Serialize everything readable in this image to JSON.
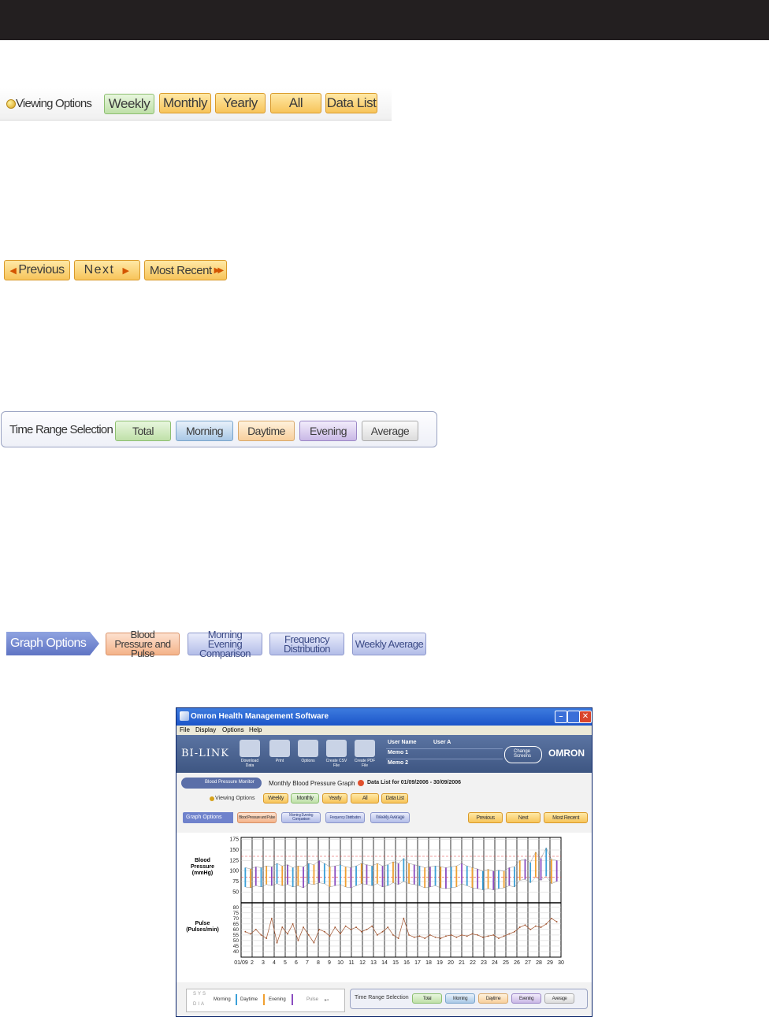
{
  "viewing_options": {
    "label": "Viewing Options",
    "buttons": [
      "Weekly",
      "Monthly",
      "Yearly",
      "All",
      "Data List"
    ]
  },
  "navigation": {
    "previous": "Previous",
    "next": "Next",
    "most_recent": "Most Recent"
  },
  "time_range": {
    "label": "Time Range Selection",
    "buttons": [
      "Total",
      "Morning",
      "Daytime",
      "Evening",
      "Average"
    ]
  },
  "graph_options": {
    "label": "Graph Options",
    "buttons": [
      "Blood Pressure and Pulse",
      "Morning Evening Comparison",
      "Frequency Distribution",
      "Weekly Average"
    ]
  },
  "app": {
    "title": "Omron Health Management Software",
    "menu": [
      "File",
      "Display",
      "Options",
      "Help"
    ],
    "logo": "BI-LINK",
    "brand": "OMRON",
    "toolbar": [
      "Download Data",
      "Print",
      "Options",
      "Create CSV File",
      "Create PDF File"
    ],
    "user_fields": [
      {
        "label": "User Name",
        "value": "User A"
      },
      {
        "label": "Memo 1",
        "value": ""
      },
      {
        "label": "Memo 2",
        "value": ""
      }
    ],
    "change_screens": "Change Screens",
    "monitor_label": "Blood Pressure Monitor",
    "graph_title": "Monthly Blood Pressure Graph",
    "data_list_range": "Data List for 01/09/2006 - 30/09/2006",
    "legend": {
      "sys": "SYS",
      "dia": "DIA",
      "morning": "Morning",
      "daytime": "Daytime",
      "evening": "Evening",
      "pulse": "Pulse"
    }
  },
  "chart_data": {
    "type": "bar",
    "panels": [
      {
        "ylabel": "Blood Pressure (mmHg)",
        "yticks": [
          50,
          75,
          100,
          125,
          150,
          175
        ],
        "ylim": [
          30,
          180
        ],
        "reference_lines": [
          135,
          85
        ]
      },
      {
        "ylabel": "Pulse (Pulses/min)",
        "yticks": [
          40,
          45,
          50,
          55,
          60,
          65,
          70,
          75,
          80
        ],
        "ylim": [
          35,
          82
        ]
      }
    ],
    "x_ticks": [
      "01/09",
      "2",
      "3",
      "4",
      "5",
      "6",
      "7",
      "8",
      "9",
      "10",
      "11",
      "12",
      "13",
      "14",
      "15",
      "16",
      "17",
      "18",
      "19",
      "20",
      "21",
      "22",
      "23",
      "24",
      "25",
      "26",
      "27",
      "28",
      "29",
      "30"
    ],
    "bp_sys": [
      108,
      105,
      110,
      108,
      112,
      110,
      118,
      112,
      115,
      108,
      112,
      110,
      118,
      115,
      125,
      118,
      110,
      112,
      115,
      110,
      108,
      112,
      118,
      115,
      112,
      118,
      112,
      115,
      122,
      118,
      130,
      118,
      115,
      112,
      108,
      110,
      112,
      110,
      108,
      110,
      112,
      118,
      112,
      108,
      105,
      100,
      104,
      100,
      102,
      100,
      108,
      110,
      125,
      128,
      120,
      145,
      130,
      155,
      128,
      125
    ],
    "bp_dia": [
      62,
      60,
      65,
      62,
      68,
      65,
      70,
      65,
      68,
      62,
      65,
      60,
      70,
      68,
      72,
      70,
      62,
      65,
      68,
      62,
      60,
      65,
      70,
      68,
      65,
      70,
      62,
      65,
      72,
      68,
      75,
      70,
      68,
      65,
      60,
      62,
      65,
      60,
      58,
      60,
      62,
      70,
      65,
      60,
      58,
      55,
      58,
      55,
      58,
      60,
      65,
      62,
      78,
      80,
      72,
      85,
      78,
      88,
      70,
      75
    ],
    "pulse": [
      58,
      56,
      60,
      55,
      52,
      70,
      48,
      62,
      56,
      65,
      50,
      62,
      55,
      48,
      60,
      58,
      54,
      62,
      56,
      63,
      60,
      62,
      58,
      60,
      63,
      55,
      58,
      62,
      55,
      52,
      70,
      55,
      53,
      54,
      52,
      55,
      53,
      52,
      54,
      55,
      53,
      55,
      54,
      56,
      55,
      53,
      54,
      55,
      52,
      54,
      56,
      58,
      62,
      64,
      60,
      63,
      62,
      65,
      70,
      67
    ]
  }
}
